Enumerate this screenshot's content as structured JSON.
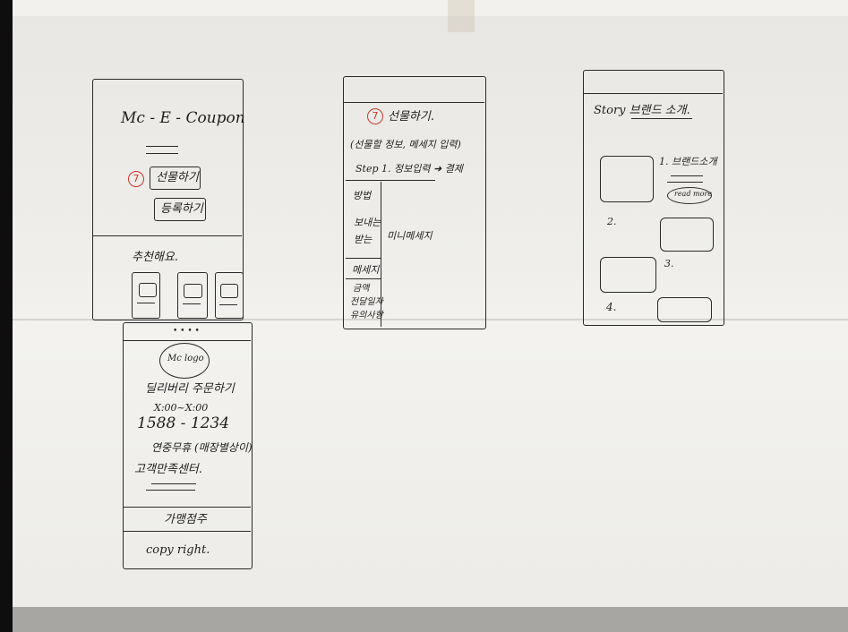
{
  "sketch1": {
    "title": "Mc - E - Coupon",
    "badge": "7",
    "btn_gift": "선물하기",
    "btn_register": "등록하기",
    "recommend": "추천해요.",
    "dots": "• • • •"
  },
  "sketch1b": {
    "logo": "Mc logo",
    "delivery": "딜리버리 주문하기",
    "hours": "X:00~X:00",
    "phone": "1588 - 1234",
    "hours_note": "연중무휴 (매장별상이)",
    "center": "고객만족센터.",
    "franchise": "가맹점주",
    "copyright": "copy right."
  },
  "sketch2": {
    "badge": "7",
    "title": "선물하기.",
    "subtitle": "(선물할 정보, 메세지 입력)",
    "step": "Step 1. 정보입력 ➜ 결제",
    "rows": [
      "방법",
      "보내는",
      "받는",
      "메세지",
      "금액",
      "전달일자",
      "유의사항"
    ],
    "message_col": "미니메세지"
  },
  "sketch3": {
    "title": "Story 브랜드 소개.",
    "item1": "1. 브랜드소개",
    "readmore": "read more",
    "item2": "2.",
    "item3": "3.",
    "item4": "4."
  }
}
